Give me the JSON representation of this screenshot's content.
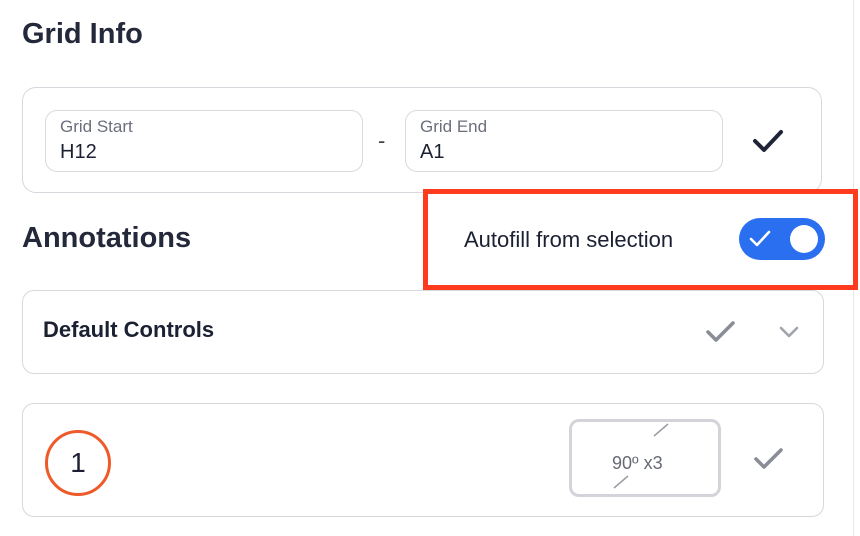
{
  "grid_info": {
    "title": "Grid Info",
    "start": {
      "label": "Grid Start",
      "value": "H12"
    },
    "separator": "-",
    "end": {
      "label": "Grid End",
      "value": "A1"
    },
    "confirm_icon": "check-icon"
  },
  "annotations": {
    "title": "Annotations",
    "autofill": {
      "label": "Autofill from selection",
      "enabled": true,
      "accent": "#2a6ff0"
    },
    "highlight_color": "#ff3b1f",
    "default_controls": {
      "label": "Default Controls"
    },
    "items": [
      {
        "number": "1",
        "rotation": "90º x3"
      }
    ]
  }
}
